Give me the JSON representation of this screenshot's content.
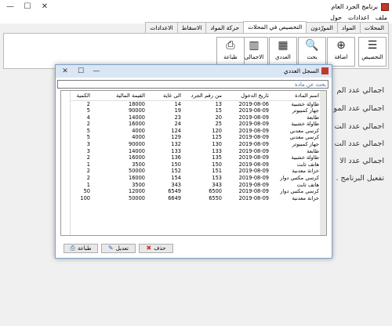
{
  "window": {
    "title": "برنامج الجرد العام",
    "minimize": "—",
    "maximize": "☐",
    "close": "✕"
  },
  "menu": [
    "ملف",
    "اعدادات",
    "حول"
  ],
  "tabs": [
    {
      "label": "المحلات",
      "active": false
    },
    {
      "label": "المواد",
      "active": false
    },
    {
      "label": "المورّدون",
      "active": false
    },
    {
      "label": "التخصيص في المحلات",
      "active": true
    },
    {
      "label": "حركة المواد",
      "active": false
    },
    {
      "label": "الاسقاط",
      "active": false
    },
    {
      "label": "الاعدادات",
      "active": false
    }
  ],
  "ribbon": {
    "custom": {
      "label": "التخصيص",
      "icon": "list-icon",
      "glyph": "☰"
    },
    "add": {
      "label": "اضافة",
      "icon": "plus-circle-icon",
      "glyph": "⊕"
    },
    "search": {
      "label": "بحث",
      "icon": "search-icon",
      "glyph": "🔍"
    },
    "count": {
      "label": "العددي",
      "icon": "calculator-icon",
      "glyph": "▦"
    },
    "total": {
      "label": "الاجمالي",
      "icon": "chart-icon",
      "glyph": "▥"
    },
    "print": {
      "label": "طباعة",
      "icon": "printer-icon",
      "glyph": "⎙"
    }
  },
  "stats": [
    "اجمالي عدد الم",
    "اجمالي عدد المو",
    "اجمالي عدد الت",
    "اجمالي عدد الت",
    "اجمالي عدد الا",
    "تفعيل البرنامج ."
  ],
  "dialog": {
    "title": "السجل العددي",
    "search_placeholder": "بحث عن مادة",
    "columns": [
      "اسم المادة",
      "تاريخ الدخول",
      "من رقم الجرد",
      "الى غاية",
      "القيمة المالية",
      "الكمية"
    ],
    "rows": [
      [
        "طاولة خشبية",
        "2019-08-06",
        "13",
        "14",
        "18000",
        "2"
      ],
      [
        "جهاز كمبيوتر",
        "2019-08-09",
        "15",
        "19",
        "90000",
        "5"
      ],
      [
        "طابعة",
        "2019-08-09",
        "20",
        "23",
        "14000",
        "4"
      ],
      [
        "طاولة خشبية",
        "2019-08-09",
        "25",
        "24",
        "16000",
        "2"
      ],
      [
        "كرسي معدني",
        "2019-08-09",
        "120",
        "124",
        "4000",
        "5"
      ],
      [
        "كرسي معدني",
        "2019-08-09",
        "125",
        "129",
        "4000",
        "5"
      ],
      [
        "جهاز كمبيوتر",
        "2019-08-09",
        "130",
        "132",
        "90000",
        "3"
      ],
      [
        "طابعة",
        "2019-08-09",
        "133",
        "133",
        "14000",
        "3"
      ],
      [
        "طاولة خشبية",
        "2019-08-09",
        "135",
        "136",
        "16000",
        "2"
      ],
      [
        "هاتف ثابت",
        "2019-08-09",
        "150",
        "150",
        "3500",
        "1"
      ],
      [
        "خزانة معدنية",
        "2019-08-09",
        "151",
        "152",
        "50000",
        "2"
      ],
      [
        "كرسي مكتبي دوار",
        "2019-08-09",
        "153",
        "154",
        "16000",
        "2"
      ],
      [
        "هاتف ثابت",
        "2019-08-09",
        "343",
        "343",
        "3500",
        "1"
      ],
      [
        "كرسي مكتبي دوار",
        "2019-08-09",
        "6500",
        "6549",
        "12000",
        "50"
      ],
      [
        "خزانة معدنية",
        "2019-08-09",
        "6550",
        "6649",
        "50000",
        "100"
      ]
    ],
    "buttons": {
      "delete": "حذف",
      "edit": "تعديل",
      "print": "طباعة"
    }
  }
}
